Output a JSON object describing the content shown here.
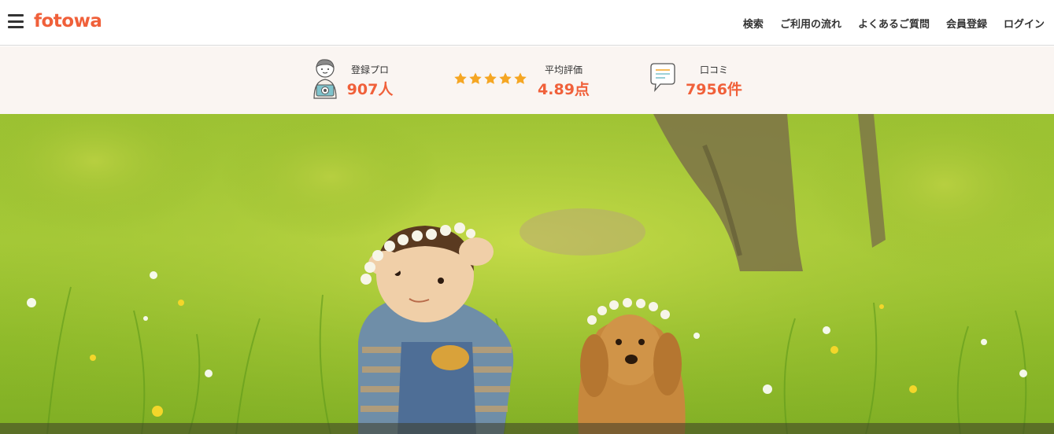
{
  "header": {
    "logo": "fotowa",
    "nav": [
      "検索",
      "ご利用の流れ",
      "よくあるご質問",
      "会員登録",
      "ログイン"
    ]
  },
  "stats": {
    "pro": {
      "label": "登録プロ",
      "value": "907人"
    },
    "rating": {
      "label": "平均評価",
      "value": "4.89点",
      "stars": 5
    },
    "reviews": {
      "label": "口コミ",
      "value": "7956件"
    }
  },
  "colors": {
    "brand": "#f0603a",
    "star": "#f5a623",
    "stats_bg": "#faf5f2"
  }
}
